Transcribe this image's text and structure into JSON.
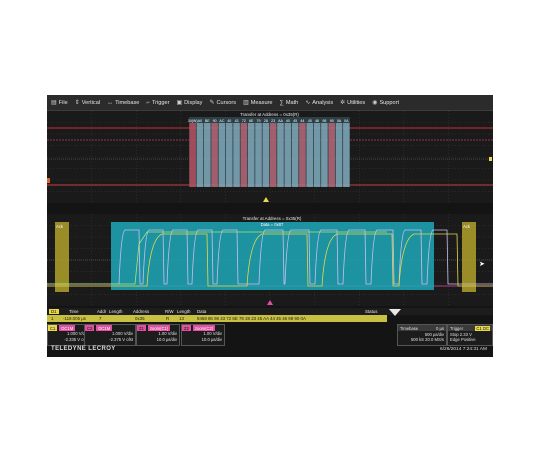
{
  "menu": [
    {
      "label": "File",
      "icon": "file-icon",
      "glyph": "▤"
    },
    {
      "label": "Vertical",
      "icon": "vertical-icon",
      "glyph": "⇕"
    },
    {
      "label": "Timebase",
      "icon": "timebase-icon",
      "glyph": "↔"
    },
    {
      "label": "Trigger",
      "icon": "trigger-icon",
      "glyph": "⌐"
    },
    {
      "label": "Display",
      "icon": "display-icon",
      "glyph": "▣"
    },
    {
      "label": "Cursors",
      "icon": "cursors-icon",
      "glyph": "✎"
    },
    {
      "label": "Measure",
      "icon": "measure-icon",
      "glyph": "▥"
    },
    {
      "label": "Math",
      "icon": "math-icon",
      "glyph": "∑"
    },
    {
      "label": "Analysis",
      "icon": "analysis-icon",
      "glyph": "∿"
    },
    {
      "label": "Utilities",
      "icon": "utilities-icon",
      "glyph": "✲"
    },
    {
      "label": "Support",
      "icon": "support-icon",
      "glyph": "◉"
    }
  ],
  "upper_grid": {
    "decode_title": "Transfer at Address = 0x35(R)",
    "decode_bytes": [
      "34(W)",
      "A0",
      "BE",
      "90",
      "AC",
      "40",
      "43",
      "72",
      "6E",
      "79",
      "28",
      "23",
      "AA",
      "40",
      "45",
      "44",
      "45",
      "46",
      "98",
      "90",
      "0A",
      "0A"
    ],
    "colors": {
      "bg": "#1a1a1a",
      "grid": "#5a3a3a",
      "trace": "#e03c3c",
      "decode_box": "#7fb4c8"
    }
  },
  "lower_grid": {
    "decode_title": "Transfer at Address = 0x35(R)",
    "data_label": "Data = 0x87",
    "ack_left": "Ack",
    "ack_right": "Ack",
    "colors": {
      "bg": "#1a1a1a",
      "decode_fill": "#1ea8b8",
      "ack_fill": "#a89a2a",
      "trace_yellow": "#e8d84a",
      "trace_lilac": "#c8c0f0",
      "trace_green": "#a8e878"
    }
  },
  "decode_table": {
    "headers": [
      "D1",
      "Time",
      "Addr",
      "Length",
      "Address",
      "R/W",
      "Length",
      "Data",
      "Status"
    ],
    "row": [
      "1",
      "-119.005 µs",
      "7",
      "",
      "0x35",
      "R",
      "13",
      "9468 86 98 43 72 6E 79 28 23 45 AA 44 45 46 98 90 0A",
      "",
      ""
    ]
  },
  "channels": [
    {
      "tag": "C1",
      "mode": "DC1M",
      "lines": [
        "1.000 V/div",
        "-2.335 V ofst"
      ],
      "color": "#e8d84a"
    },
    {
      "tag": "C2",
      "mode": "DC1M",
      "lines": [
        "1.000 V/div",
        "-2.375 V ofst"
      ],
      "color": "#e04fa0"
    },
    {
      "tag": "Z1",
      "mode": "zoom(C1)",
      "lines": [
        "1.00 V/div",
        "10.0 µs/div"
      ],
      "color": "#e04fa0"
    },
    {
      "tag": "Z2",
      "mode": "zoom(C2)",
      "lines": [
        "1.00 V/div",
        "10.0 µs/div"
      ],
      "color": "#e04fa0"
    }
  ],
  "timebase": {
    "label": "Timebase",
    "value": "0 µs",
    "lines": [
      "500 µs/div",
      "500 kS  20.0 MS/s"
    ]
  },
  "trigger": {
    "label": "Trigger",
    "tag": "C1 DC",
    "lines": [
      "Stop  2.33 V",
      "Edge  Positive"
    ]
  },
  "brand": "TELEDYNE LECROY",
  "datetime": "6/26/2014 7:24:31 AM"
}
